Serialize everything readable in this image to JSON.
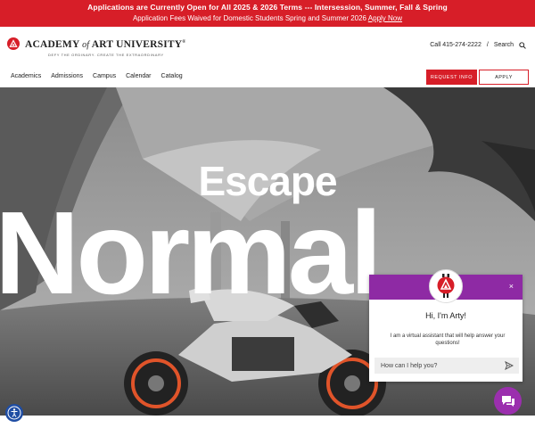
{
  "announcement": {
    "line1": "Applications are Currently Open for All 2025 & 2026 Terms --- Intersession, Summer, Fall & Spring",
    "line2_text": "Application Fees Waived for Domestic Students Spring and Summer 2026",
    "line2_link": "Apply Now"
  },
  "header": {
    "logo_academy": "ACADEMY",
    "logo_of": "of",
    "logo_art": "ART UNIVERSITY",
    "logo_reg": "®",
    "tagline": "DEFY THE ORDINARY. CREATE THE EXTRAORDINARY",
    "phone": "Call 415-274-2222",
    "separator": "/",
    "search": "Search",
    "search_icon": "search-icon"
  },
  "nav": {
    "items": [
      "Academics",
      "Admissions",
      "Campus",
      "Calendar",
      "Catalog"
    ],
    "request_info": "REQUEST INFO",
    "apply": "APPLY"
  },
  "hero": {
    "small": "Escape",
    "big": "Normal"
  },
  "chat": {
    "title": "Hi, I'm Arty!",
    "message": "I am a virtual assistant that will help answer your questions!",
    "placeholder": "How can I help you?",
    "close": "×",
    "accent": "#8e2aa4"
  },
  "colors": {
    "brand_red": "#d71e28",
    "chat_purple": "#9b2fae",
    "accessibility_blue": "#1f4da3"
  }
}
